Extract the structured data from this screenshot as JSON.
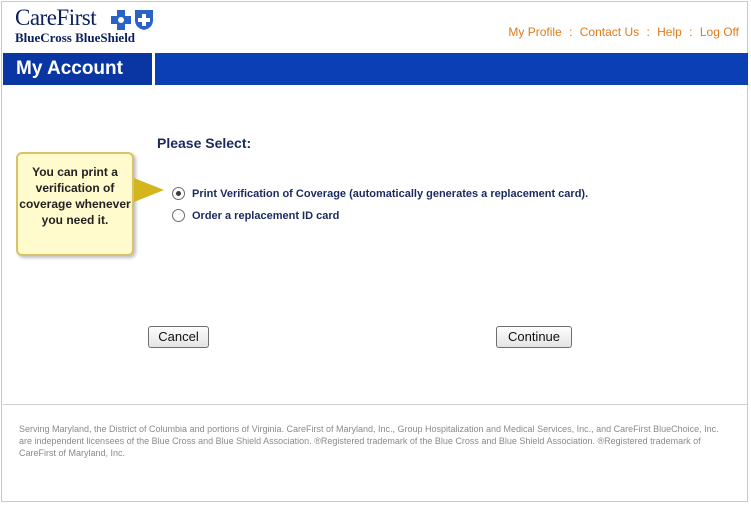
{
  "header": {
    "logo_word": "CareFirst",
    "logo_sub": "BlueCross BlueShield",
    "nav": [
      {
        "label": "My Profile"
      },
      {
        "label": "Contact Us"
      },
      {
        "label": "Help"
      },
      {
        "label": "Log Off"
      }
    ],
    "separator": ":"
  },
  "bar": {
    "title": "My Account"
  },
  "main": {
    "heading": "Please Select:",
    "options": [
      {
        "label": "Print Verification of Coverage (automatically generates a replacement card).",
        "checked": true
      },
      {
        "label": "Order a replacement ID card",
        "checked": false
      }
    ],
    "callout": "You can print a verification of coverage whenever you need it.",
    "cancel_label": "Cancel",
    "continue_label": "Continue"
  },
  "footer": {
    "text": "Serving Maryland, the District of Columbia and portions of Virginia. CareFirst of Maryland, Inc., Group Hospitalization and Medical Services, Inc., and CareFirst BlueChoice, Inc. are independent licensees of the Blue Cross and Blue Shield Association. ®Registered trademark of the Blue Cross and Blue Shield Association. ®Registered trademark of CareFirst of Maryland, Inc."
  },
  "colors": {
    "brand_blue": "#0b3fb5",
    "nav_orange": "#e07b17",
    "text_navy": "#1a2a5e",
    "callout_bg": "#fffbcc"
  },
  "icons": [
    "blue-cross-icon",
    "blue-shield-icon"
  ]
}
